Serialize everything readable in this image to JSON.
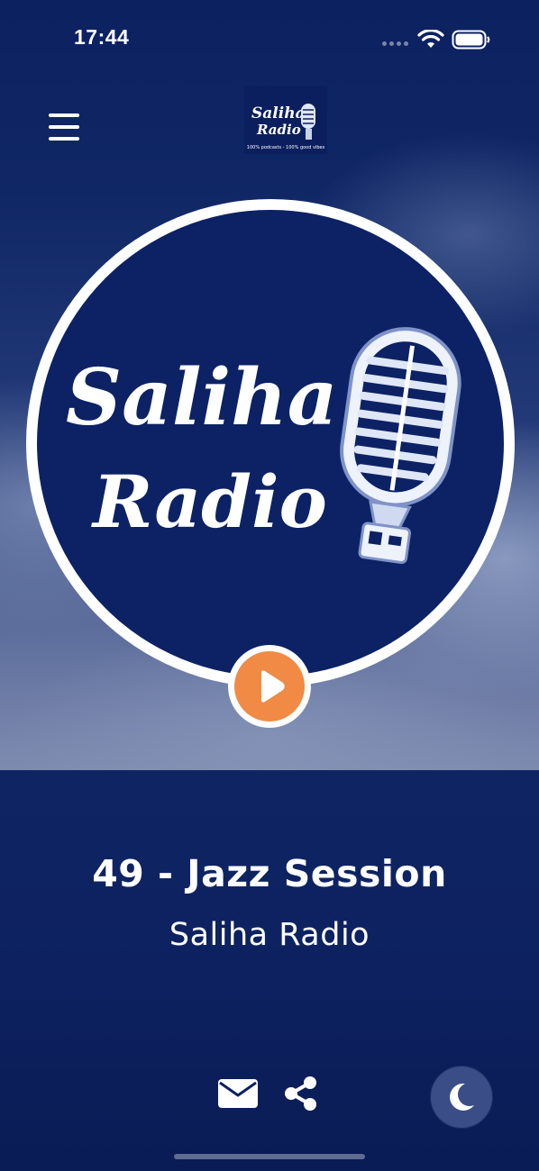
{
  "status_bar": {
    "time": "17:44",
    "icons": [
      "cellular-signal-icon",
      "wifi-icon",
      "battery-icon"
    ]
  },
  "header": {
    "menu_icon": "hamburger-menu-icon",
    "logo": {
      "line1": "Saliha",
      "line2": "Radio",
      "tagline": "100% podcasts - 100% good vibes"
    }
  },
  "artwork": {
    "line1": "Saliha",
    "line2": "Radio",
    "icon": "microphone-icon"
  },
  "player": {
    "play_icon": "play-icon",
    "track_title": "49 - Jazz Session",
    "station_name": "Saliha Radio"
  },
  "actions": {
    "mail_icon": "mail-icon",
    "share_icon": "share-icon",
    "night_icon": "moon-icon"
  },
  "colors": {
    "background": "#0f2260",
    "accent": "#f08a45",
    "night_button": "#3a4d86"
  }
}
